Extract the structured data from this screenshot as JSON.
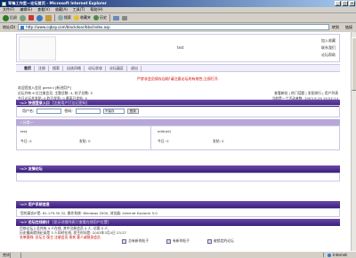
{
  "window": {
    "title": "军锋工作室—论坛首页 - Microsoft Internet Explorer",
    "controls": [
      "_",
      "□",
      "×"
    ]
  },
  "menu": [
    "文件(F)",
    "编辑(E)",
    "查看(V)",
    "收藏(A)",
    "工具(T)",
    "帮助(H)"
  ],
  "toolbar": {
    "back": "后退",
    "search": "搜索",
    "favorites": "收藏夹",
    "history": "历史"
  },
  "address": {
    "label": "地址(D)",
    "url": "http://www.cqboy.com/blackdoor/bbs/index.asp",
    "go": "转到",
    "links": "链接"
  },
  "header": {
    "site_title": "test",
    "links": [
      "加入收藏",
      "联系我们",
      "论坛帮助"
    ]
  },
  "nav": {
    "items": [
      "首页",
      "注册",
      "搜索",
      "自选风格",
      "论坛状态",
      "论坛展区",
      "退出"
    ]
  },
  "notice": "严禁非会员保存自助!请注意论坛的有效性,立即打开.",
  "user_info": {
    "line1": "欢迎您加入会员 gemini [新进用户]",
    "line2": "论坛共有 8 位注册会员, 主题总数: 4, 帖子总数: 5",
    "line3": "今日论坛共发贴: 0 昨日发贴: 0 最高日发帖: 5",
    "right1": "查看新帖 | 热门话题 | 发贴排行 | 用户列表",
    "right2": "当前是一个活动者数: 2003-9-29 15:52:14"
  },
  "quick_login": {
    "bar": "-=> 快速登录入口",
    "bar_sub": "[注册用户] [忘记密码]",
    "username_label": "用户名:",
    "password_label": "密码:",
    "save_option": "不保存",
    "submit": "登录"
  },
  "forums": {
    "category": "☆分类一",
    "left_name": "test",
    "left_stats": "今日: 0",
    "left_posts": "发贴: 0",
    "right_name": "edit(ed)",
    "right_stats": "今日: 0",
    "right_posts": "发帖: 0"
  },
  "friend_links": {
    "bar": "-=> 友情论坛"
  },
  "user_system": {
    "bar": "-=> 用户系统信息",
    "text": "您的真实IP是: 61.179.35.32, 操作系统: Windows 2000, 浏览器: Internet Explorer 5.0"
  },
  "online": {
    "bar": "-=> 论坛在线统计",
    "bar_sub": "[显示详细列表] [查看在线用户位置]",
    "line1": "目前论坛上总共有 4 人在线, 其中注册会员 4 人, 访客 0 人.",
    "line2": "历史最高就线纪录是 3 人同时在线, 发生时间是: 2003年3月4日 23:27",
    "line3": "名单图例: 总坛主 版主 注册会员 贵宾 客人或隐身会员"
  },
  "legend": [
    "总有新的帖子",
    "有新的帖子",
    "被锁定的论坛"
  ],
  "status": {
    "text": "完毕",
    "zone": "Internet"
  },
  "colors": {
    "bar_top": "#6a4aa8",
    "bar_bottom": "#3a1f7a",
    "notice": "#cc0000",
    "titlebar": "#0a246a"
  }
}
